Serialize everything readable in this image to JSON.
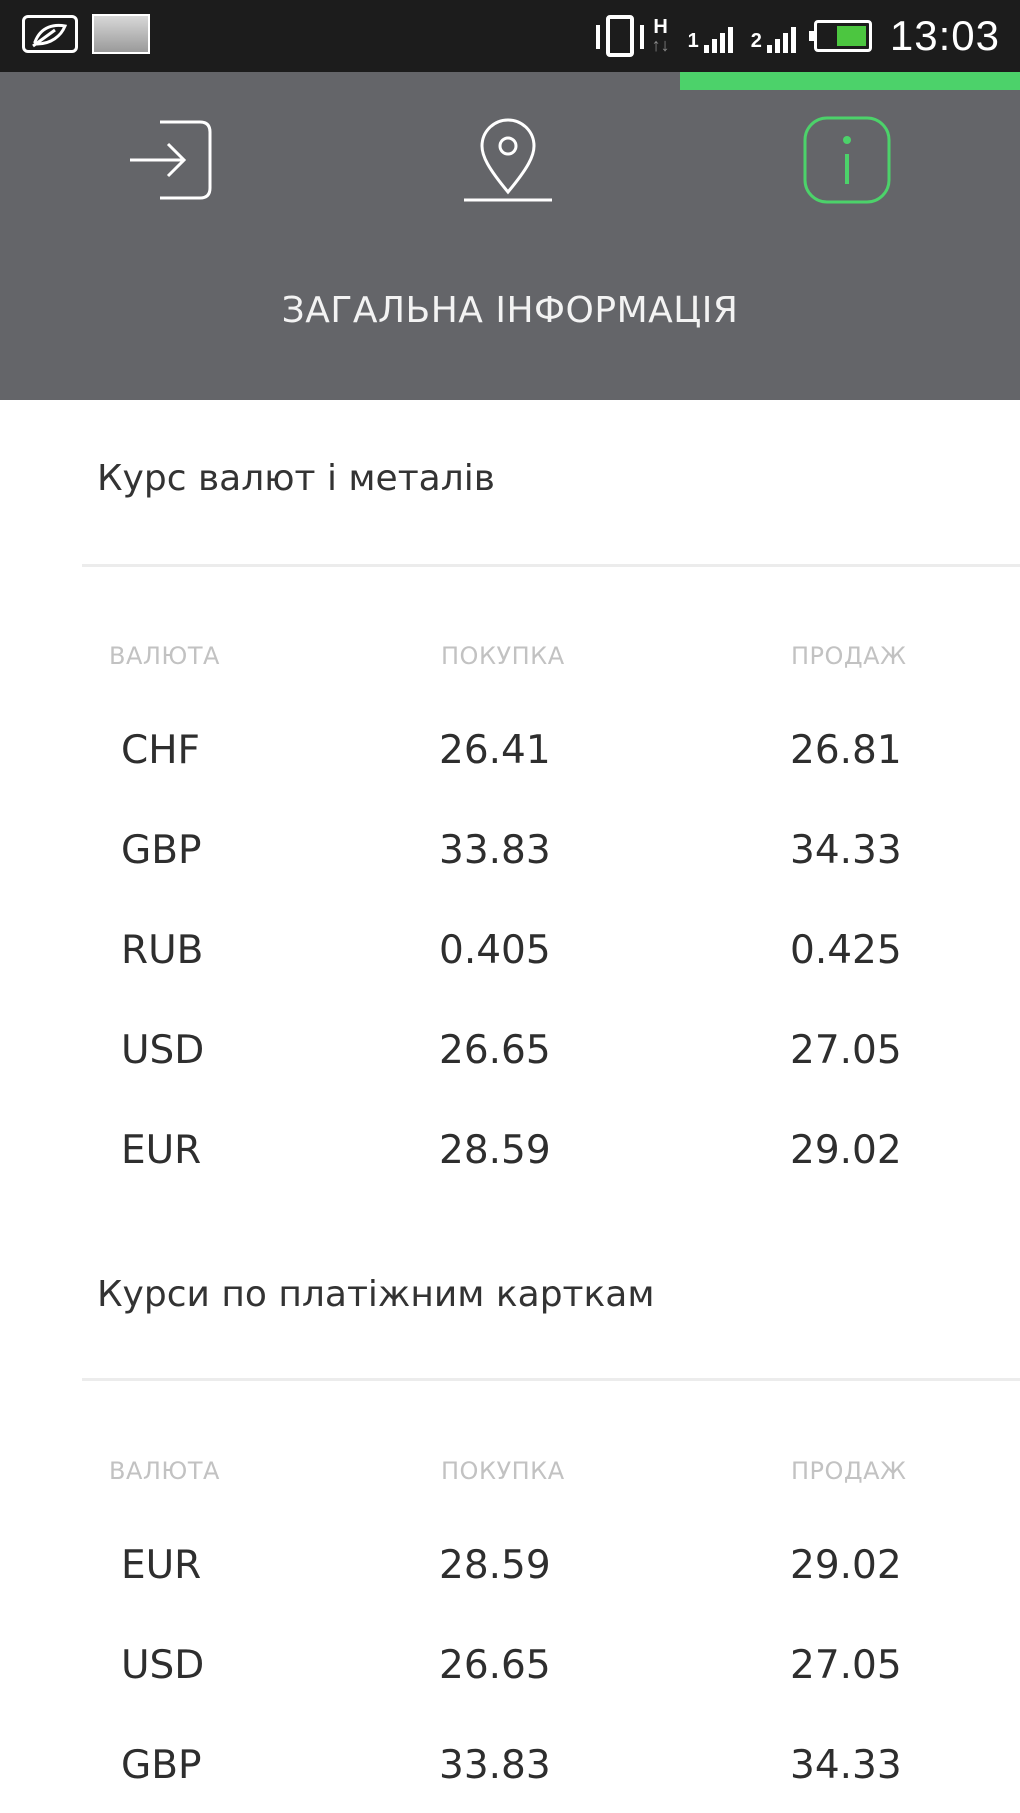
{
  "status_bar": {
    "time": "13:03",
    "network_type": "H",
    "sim1_label": "1",
    "sim2_label": "2",
    "network_arrows": "↑↓",
    "battery_color": "#4cc640",
    "battery_level": 0.64
  },
  "header": {
    "tabs": [
      {
        "icon": "login-icon",
        "active": false
      },
      {
        "icon": "location-pin-icon",
        "active": false
      },
      {
        "icon": "info-icon",
        "active": true
      }
    ],
    "title": "ЗАГАЛЬНА ІНФОРМАЦІЯ",
    "background_color": "#646569",
    "accent_color": "#4cd26a"
  },
  "sections": [
    {
      "title": "Курс валют і металів",
      "columns": [
        "ВАЛЮТА",
        "ПОКУПКА",
        "ПРОДАЖ"
      ],
      "rows": [
        {
          "currency": "CHF",
          "buy": "26.41",
          "sell": "26.81"
        },
        {
          "currency": "GBP",
          "buy": "33.83",
          "sell": "34.33"
        },
        {
          "currency": "RUB",
          "buy": "0.405",
          "sell": "0.425"
        },
        {
          "currency": "USD",
          "buy": "26.65",
          "sell": "27.05"
        },
        {
          "currency": "EUR",
          "buy": "28.59",
          "sell": "29.02"
        }
      ]
    },
    {
      "title": "Курси по платіжним карткам",
      "columns": [
        "ВАЛЮТА",
        "ПОКУПКА",
        "ПРОДАЖ"
      ],
      "rows": [
        {
          "currency": "EUR",
          "buy": "28.59",
          "sell": "29.02"
        },
        {
          "currency": "USD",
          "buy": "26.65",
          "sell": "27.05"
        },
        {
          "currency": "GBP",
          "buy": "33.83",
          "sell": "34.33"
        }
      ]
    }
  ]
}
